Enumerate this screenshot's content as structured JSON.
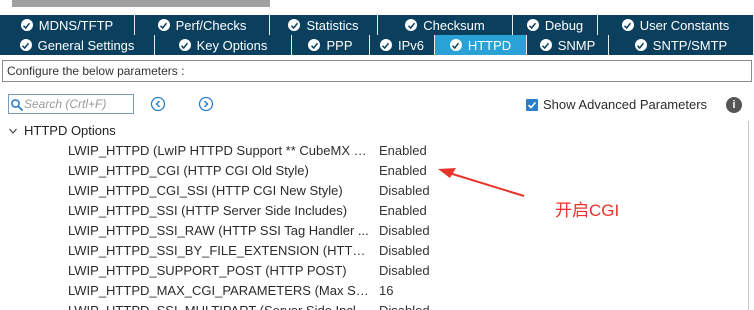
{
  "tabs_row1": [
    {
      "label": "MDNS/TFTP",
      "width": 135
    },
    {
      "label": "Perf/Checks",
      "width": 135
    },
    {
      "label": "Statistics",
      "width": 108
    },
    {
      "label": "Checksum",
      "width": 135
    },
    {
      "label": "Debug",
      "width": 85
    },
    {
      "label": "User Constants",
      "width": 156
    }
  ],
  "tabs_row2": [
    {
      "label": "General Settings",
      "width": 155,
      "active": false
    },
    {
      "label": "Key Options",
      "width": 137,
      "active": false
    },
    {
      "label": "PPP",
      "width": 78,
      "active": false
    },
    {
      "label": "IPv6",
      "width": 65,
      "active": false
    },
    {
      "label": "HTTPD",
      "width": 92,
      "active": true
    },
    {
      "label": "SNMP",
      "width": 82,
      "active": false
    },
    {
      "label": "SNTP/SMTP",
      "width": 145,
      "active": false
    }
  ],
  "config_label": "Configure the below parameters :",
  "search": {
    "placeholder": "Search (Crtl+F)"
  },
  "show_advanced": {
    "label": "Show Advanced Parameters",
    "checked": true
  },
  "group_label": "HTTPD Options",
  "parameters": [
    {
      "name": "LWIP_HTTPD (LwIP HTTPD Support ** CubeMX sp...",
      "value": "Enabled"
    },
    {
      "name": "LWIP_HTTPD_CGI (HTTP CGI Old Style)",
      "value": "Enabled"
    },
    {
      "name": "LWIP_HTTPD_CGI_SSI (HTTP CGI New Style)",
      "value": "Disabled"
    },
    {
      "name": "LWIP_HTTPD_SSI (HTTP Server Side Includes)",
      "value": "Enabled"
    },
    {
      "name": "LWIP_HTTPD_SSI_RAW (HTTP SSI Tag Handler ...",
      "value": "Disabled"
    },
    {
      "name": "LWIP_HTTPD_SSI_BY_FILE_EXTENSION (HTTP ...",
      "value": "Disabled"
    },
    {
      "name": "LWIP_HTTPD_SUPPORT_POST (HTTP POST)",
      "value": "Disabled"
    },
    {
      "name": "LWIP_HTTPD_MAX_CGI_PARAMETERS (Max Se...",
      "value": "16"
    },
    {
      "name": "LWIP_HTTPD_SSI_MULTIPART (Server Side Inclu...",
      "value": "Disabled"
    }
  ],
  "annotation": {
    "text": "开启CGI",
    "color": "#e8332a"
  },
  "colors": {
    "tab_bg": "#0b3f5e",
    "tab_active": "#2aa2d6",
    "checkbox": "#2c7fc7"
  },
  "icons": {
    "tab_status": "check-circle-icon",
    "search": "search-icon",
    "prev": "chevron-left-circle-icon",
    "next": "chevron-right-circle-icon",
    "info": "info-icon",
    "group_toggle": "chevron-down-icon"
  }
}
